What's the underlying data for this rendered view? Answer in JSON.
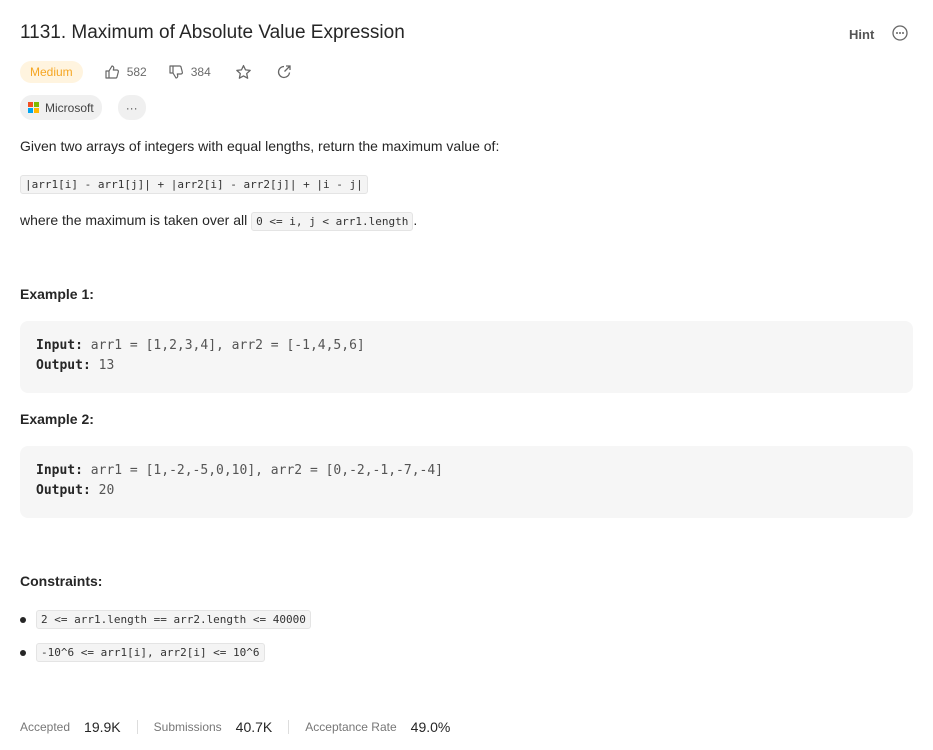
{
  "problem": {
    "title": "1131. Maximum of Absolute Value Expression",
    "hint_label": "Hint",
    "difficulty": "Medium",
    "likes": "582",
    "dislikes": "384",
    "company_tag": "Microsoft",
    "more_tags": "···"
  },
  "description": {
    "intro": "Given two arrays of integers with equal lengths, return the maximum value of:",
    "expression": "|arr1[i] - arr1[j]| + |arr2[i] - arr2[j]| + |i - j|",
    "where_prefix": "where the maximum is taken over all ",
    "where_code": "0 <= i, j < arr1.length",
    "where_suffix": "."
  },
  "examples": [
    {
      "heading": "Example 1:",
      "input_label": "Input:",
      "input": "arr1 = [1,2,3,4], arr2 = [-1,4,5,6]",
      "output_label": "Output:",
      "output": "13"
    },
    {
      "heading": "Example 2:",
      "input_label": "Input:",
      "input": "arr1 = [1,-2,-5,0,10], arr2 = [0,-2,-1,-7,-4]",
      "output_label": "Output:",
      "output": "20"
    }
  ],
  "constraints": {
    "heading": "Constraints:",
    "items": [
      "2 <= arr1.length == arr2.length <= 40000",
      "-10^6 <= arr1[i], arr2[i] <= 10^6"
    ]
  },
  "stats": {
    "accepted_label": "Accepted",
    "accepted": "19.9K",
    "submissions_label": "Submissions",
    "submissions": "40.7K",
    "rate_label": "Acceptance Rate",
    "rate": "49.0%"
  },
  "colors": {
    "medium": "#f5a623",
    "medium_bg": "#fff4df",
    "code_bg": "#f6f6f6"
  }
}
